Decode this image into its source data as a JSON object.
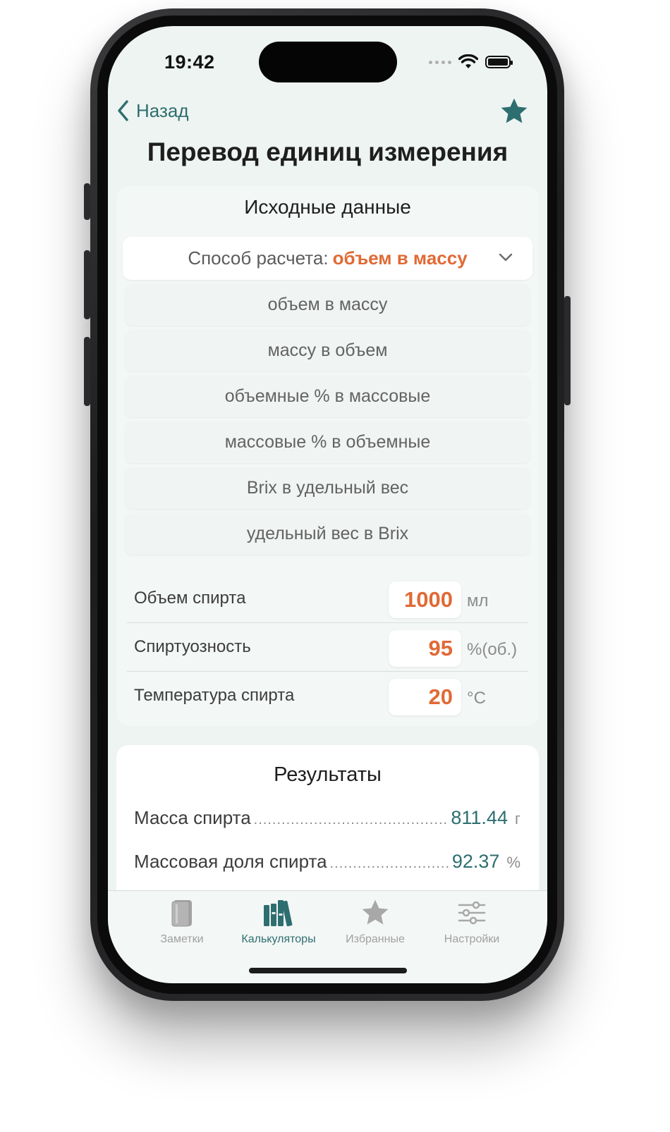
{
  "status_bar": {
    "time": "19:42"
  },
  "nav": {
    "back_label": "Назад"
  },
  "page_title": "Перевод единиц измерения",
  "input_card": {
    "title": "Исходные данные",
    "method_prefix": "Способ расчета:",
    "method_value": "объем в массу",
    "options": [
      "объем в массу",
      "массу в объем",
      "объемные % в массовые",
      "массовые % в объемные",
      "Brix в удельный вес",
      "удельный вес в Brix"
    ],
    "fields": [
      {
        "label": "Объем спирта",
        "value": "1000",
        "unit": "мл"
      },
      {
        "label": "Спиртуозность",
        "value": "95",
        "unit": "%(об.)"
      },
      {
        "label": "Температура спирта",
        "value": "20",
        "unit": "°C"
      }
    ]
  },
  "results_card": {
    "title": "Результаты",
    "rows": [
      {
        "label": "Масса спирта",
        "value": "811.44",
        "unit": "г"
      },
      {
        "label": "Массовая доля спирта",
        "value": "92.37",
        "unit": "%"
      }
    ]
  },
  "tabbar": {
    "tabs": [
      {
        "label": "Заметки",
        "icon": "notebook-icon",
        "active": false
      },
      {
        "label": "Калькуляторы",
        "icon": "books-icon",
        "active": true
      },
      {
        "label": "Избранные",
        "icon": "star-icon",
        "active": false
      },
      {
        "label": "Настройки",
        "icon": "sliders-icon",
        "active": false
      }
    ]
  },
  "colors": {
    "accent_teal": "#2e6e70",
    "accent_orange": "#e06a35",
    "screen_background": "#eef4f1"
  }
}
